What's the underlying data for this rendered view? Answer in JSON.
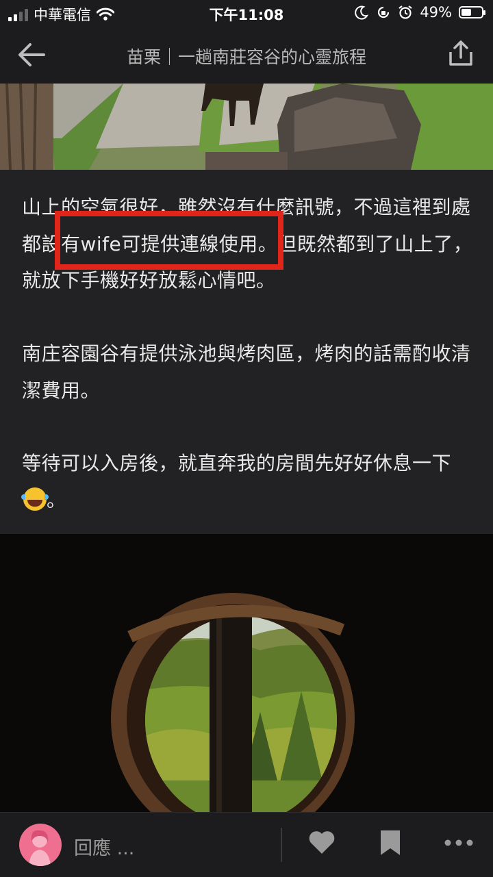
{
  "status_bar": {
    "carrier": "中華電信",
    "time": "下午11:08",
    "battery_percent": "49%",
    "battery_level": 0.49,
    "icons": [
      "signal-icon",
      "wifi-icon",
      "moon-icon",
      "rotation-lock-icon",
      "alarm-icon",
      "battery-icon"
    ]
  },
  "header": {
    "title": "苗栗｜一趟南莊容谷的心靈旅程",
    "back_icon": "arrow-left-icon",
    "share_icon": "share-icon"
  },
  "article": {
    "paragraphs": [
      "山上的空氣很好，雖然沒有什麼訊號，不過這裡到處都設有wife可提供連線使用。但既然都到了山上了，就放下手機好好放鬆心情吧。",
      "南庄容園谷有提供泳池與烤肉區，烤肉的話需酌收清潔費用。",
      "等待可以入房後，就直奔我的房間先好好休息一下",
      "。"
    ],
    "emoji": "face-with-tears-of-joy",
    "highlight_color": "#e1251b"
  },
  "bottom_bar": {
    "reply_label": "回應 ...",
    "icons": [
      "avatar-icon",
      "heart-icon",
      "bookmark-icon",
      "more-icon"
    ]
  },
  "colors": {
    "background": "#1c1c1e",
    "article_background": "#222224",
    "text": "#e8e8e8",
    "avatar": "#ee6f8f"
  }
}
